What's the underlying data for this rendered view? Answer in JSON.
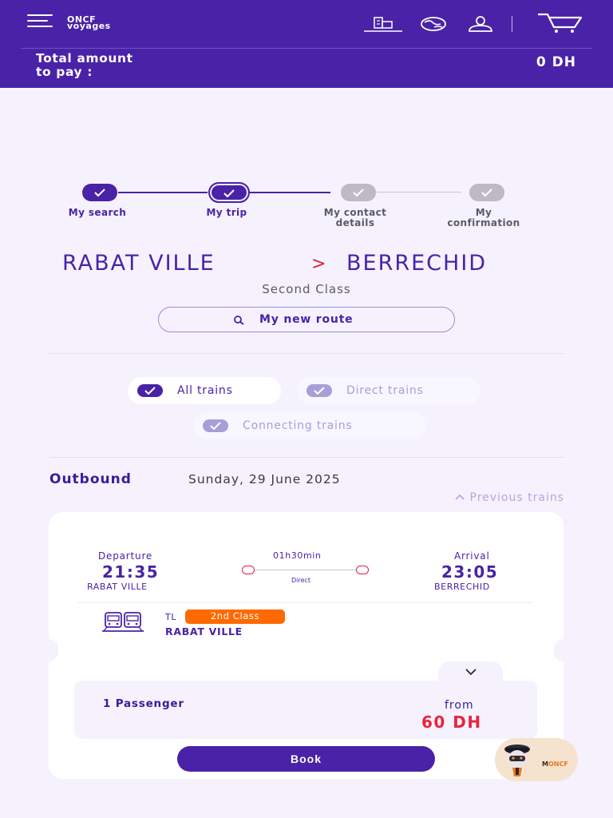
{
  "header": {
    "logo_line1": "ONCF",
    "logo_line2": "voyages",
    "total_label": "Total amount\nto pay :",
    "total_amount": "0 DH",
    "icons": [
      "menu-icon",
      "station-icon",
      "globe-icon",
      "user-icon",
      "cart-icon"
    ]
  },
  "stepper": {
    "steps": [
      {
        "label": "My search",
        "state": "done"
      },
      {
        "label": "My trip",
        "state": "current"
      },
      {
        "label": "My contact\ndetails",
        "state": "pending"
      },
      {
        "label": "My\nconfirmation",
        "state": "pending"
      }
    ]
  },
  "route": {
    "origin": "RABAT VILLE",
    "separator": ">",
    "destination": "BERRECHID",
    "travel_class": "Second Class",
    "new_route_label": "My new route"
  },
  "filters": [
    {
      "label": "All trains",
      "selected": true
    },
    {
      "label": "Direct trains",
      "selected": false
    },
    {
      "label": "Connecting trains",
      "selected": false
    }
  ],
  "outbound": {
    "title": "Outbound",
    "date": "Sunday, 29 June 2025",
    "previous_trains": "Previous trains"
  },
  "trip": {
    "departure_label": "Departure",
    "departure_time": "21:35",
    "departure_station": "RABAT VILLE",
    "duration": "01h30min",
    "connection_type": "Direct",
    "arrival_label": "Arrival",
    "arrival_time": "23:05",
    "arrival_station": "BERRECHID",
    "train_code": "TL",
    "class_badge": "2nd Class",
    "train_station": "RABAT VILLE",
    "passengers": "1 Passenger",
    "from_label": "from",
    "price": "60 DH",
    "book_label": "Book"
  },
  "chatbot": {
    "brand_prefix": "M",
    "brand_suffix": "ONCF"
  },
  "colors": {
    "primary": "#4a22a8",
    "background": "#f5f2fd",
    "accent_red": "#e8243f",
    "badge_orange": "#ff6a00",
    "inactive": "#bdbac6"
  }
}
